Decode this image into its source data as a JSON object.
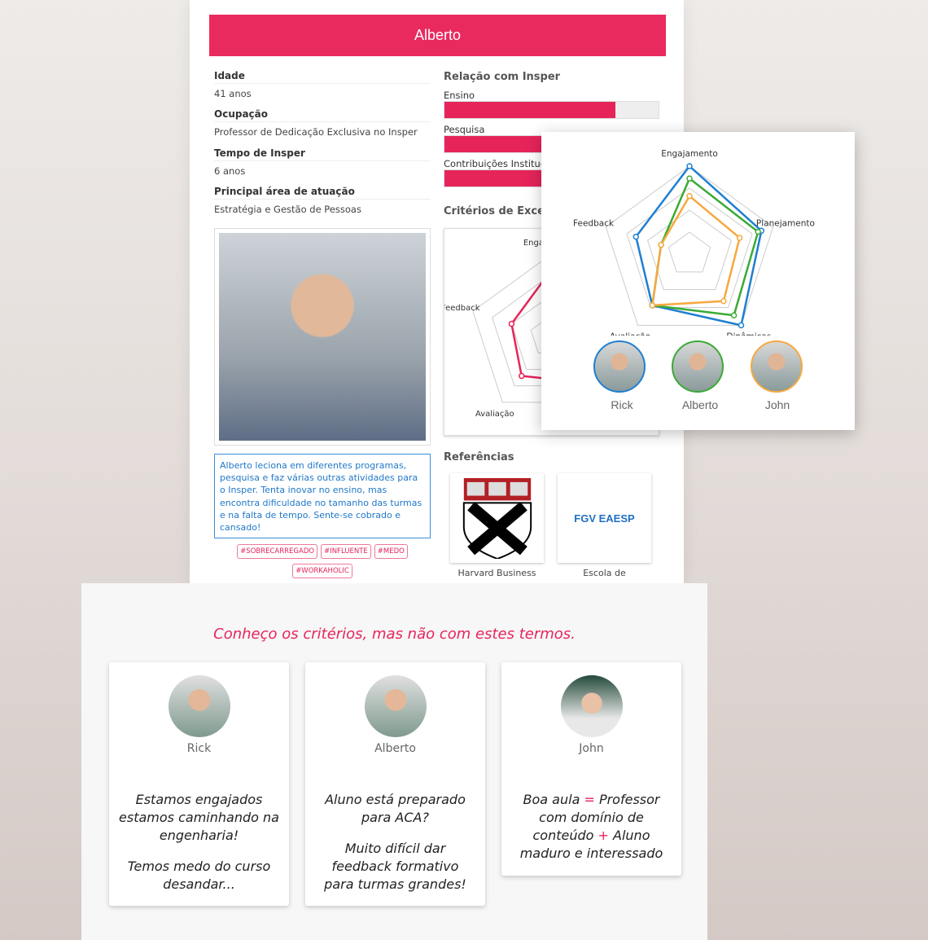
{
  "profile": {
    "name": "Alberto",
    "fields": [
      {
        "label": "Idade",
        "value": "41 anos"
      },
      {
        "label": "Ocupação",
        "value": "Professor de Dedicação Exclusiva no Insper"
      },
      {
        "label": "Tempo de Insper",
        "value": "6 anos"
      },
      {
        "label": "Principal área de atuação",
        "value": "Estratégia e Gestão de Pessoas"
      }
    ],
    "bio": "Alberto leciona em diferentes programas, pesquisa e faz várias outras atividades para o Insper. Tenta inovar no ensino, mas encontra dificuldade no tamanho das turmas e na falta de tempo. Sente-se cobrado e cansado!",
    "tags": [
      "#SOBRECARREGADO",
      "#INFLUENTE",
      "#MEDO",
      "#WORKAHOLIC"
    ]
  },
  "relation": {
    "title": "Relação com Insper",
    "items": [
      {
        "label": "Ensino",
        "percent": 80
      },
      {
        "label": "Pesquisa",
        "percent": 90
      },
      {
        "label": "Contribuições Institucionais",
        "percent": 90
      }
    ]
  },
  "criteria": {
    "title": "Critérios de Excelência"
  },
  "references": {
    "title": "Referências",
    "items": [
      {
        "name": "Harvard Business",
        "logo": "VE RI TAS"
      },
      {
        "name": "Escola de",
        "logo": "FGV EAESP"
      }
    ]
  },
  "chart_data": [
    {
      "type": "radar",
      "axes": [
        "Engajamento",
        "Planejamento",
        "Dinâmicas",
        "Avaliação",
        "Feedback"
      ],
      "range": [
        0,
        5
      ],
      "series": [
        {
          "name": "Alberto",
          "color": "#e6245a",
          "values": [
            4,
            3.5,
            3.5,
            3,
            2.5
          ]
        }
      ]
    },
    {
      "type": "radar",
      "axes": [
        "Engajamento",
        "Planejamento",
        "Dinâmicas",
        "Avaliação",
        "Feedback"
      ],
      "range": [
        0,
        5
      ],
      "series": [
        {
          "name": "Rick",
          "color": "#1f7fd1",
          "values": [
            5,
            4.3,
            5,
            3.6,
            3.2
          ]
        },
        {
          "name": "Alberto",
          "color": "#3aaa35",
          "values": [
            4.3,
            4.1,
            4.3,
            3.6,
            1.7
          ]
        },
        {
          "name": "John",
          "color": "#f6a940",
          "values": [
            3.3,
            3,
            3.3,
            3.6,
            1.7
          ]
        }
      ]
    }
  ],
  "personas": [
    {
      "name": "Rick",
      "color": "#1f7fd1"
    },
    {
      "name": "Alberto",
      "color": "#3aaa35"
    },
    {
      "name": "John",
      "color": "#f6a940"
    }
  ],
  "bottom": {
    "quote": "Conheço os critérios, mas não com estes termos.",
    "cards": [
      {
        "name": "Rick",
        "paragraphs": [
          "Estamos engajados estamos caminhando na engenharia!",
          "Temos medo do curso desandar..."
        ]
      },
      {
        "name": "Alberto",
        "paragraphs": [
          "Aluno está preparado para ACA?",
          "Muito difícil dar feedback formativo para turmas grandes!"
        ]
      },
      {
        "name": "John",
        "parts": [
          "Boa aula ",
          "=",
          "Professor com domínio de conteúdo ",
          "+",
          "Aluno maduro e interessado"
        ]
      }
    ]
  }
}
